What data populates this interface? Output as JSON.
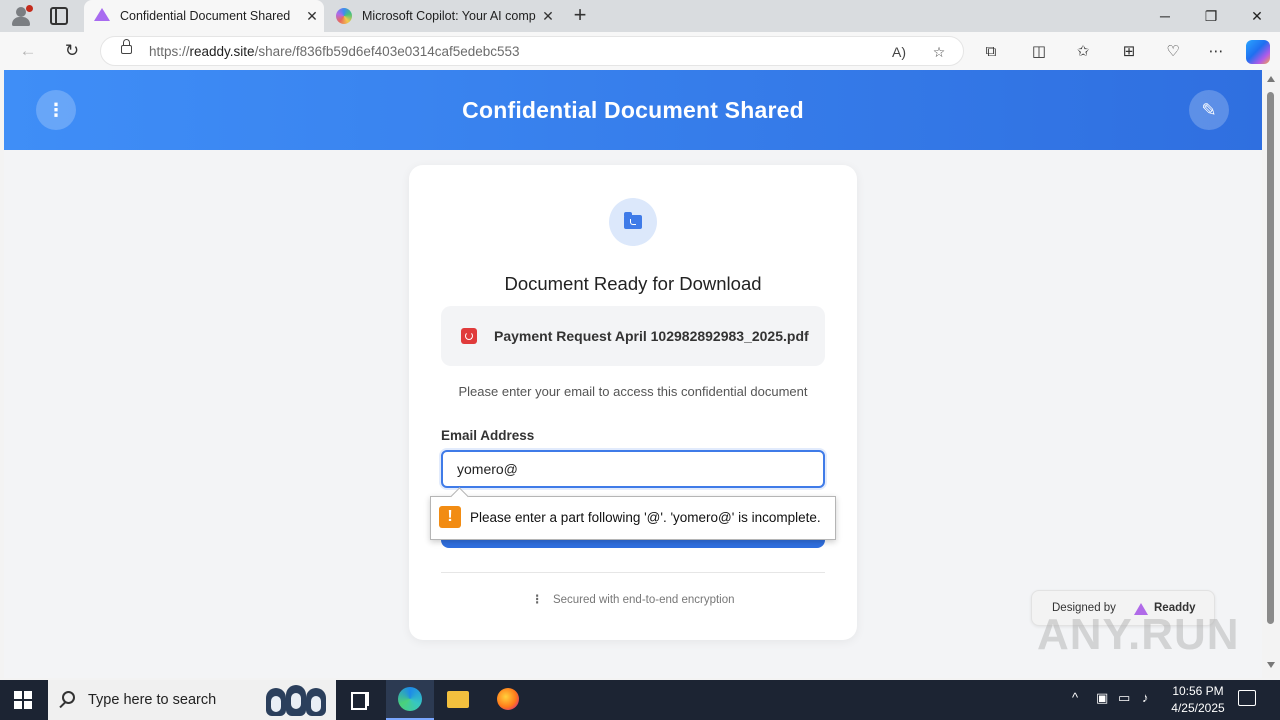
{
  "browser": {
    "tabs": [
      {
        "title": "Confidential Document Shared",
        "active": true
      },
      {
        "title": "Microsoft Copilot: Your AI comp",
        "active": false
      }
    ],
    "url_prefix": "https://",
    "url_host": "readdy.site",
    "url_path": "/share/f836fb59d6ef403e0314caf5edebc553"
  },
  "page": {
    "header_title": "Confidential Document Shared",
    "card_title": "Document Ready for Download",
    "file_name": "Payment Request April 102982892983_2025.pdf",
    "instruction": "Please enter your email to access this confidential document",
    "email_label": "Email Address",
    "email_value": "yomero@",
    "validation_message": "Please enter a part following '@'. 'yomero@' is incomplete.",
    "secure_note": "Secured with end-to-end encryption",
    "badge_designed_by": "Designed by",
    "badge_brand": "Readdy"
  },
  "watermark": "ANY.RUN",
  "taskbar": {
    "search_placeholder": "Type here to search",
    "time": "10:56 PM",
    "date": "4/25/2025"
  },
  "colors": {
    "header_gradient_start": "#3f8ef7",
    "header_gradient_end": "#2f6fe0",
    "accent": "#3f7be8",
    "warning": "#f28c13",
    "pdf_red": "#e03b3b"
  }
}
